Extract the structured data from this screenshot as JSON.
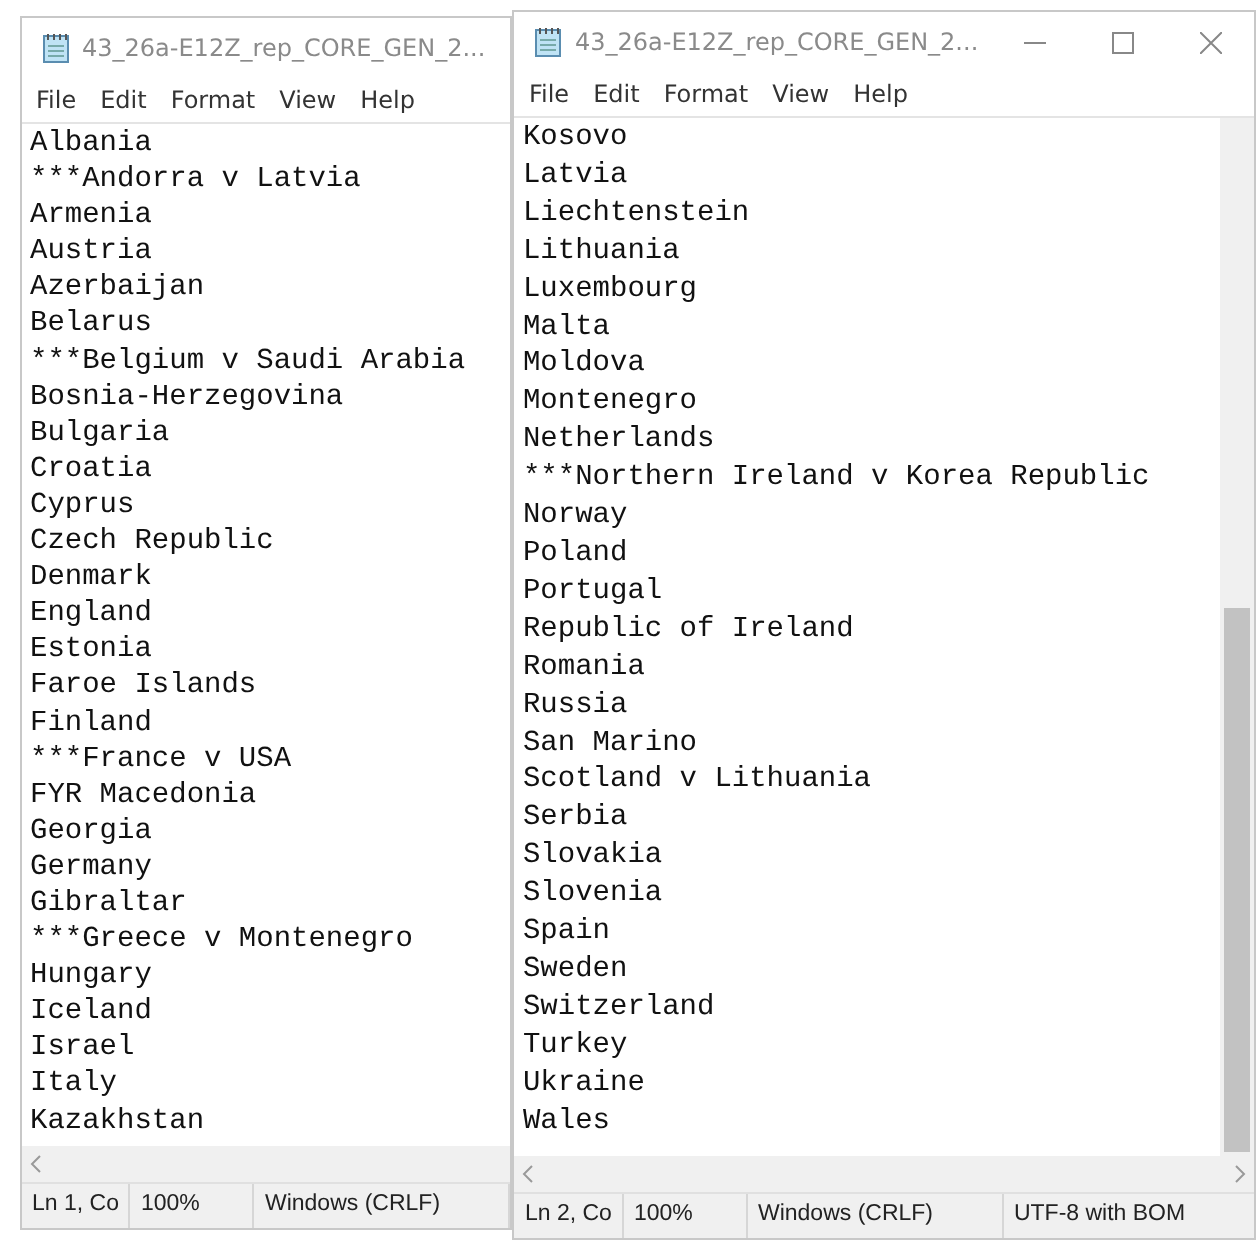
{
  "windows": [
    {
      "title": "43_26a-E12Z_rep_CORE_GEN_2...",
      "caption_buttons": false,
      "vertical_scrollbar": false,
      "menu": [
        "File",
        "Edit",
        "Format",
        "View",
        "Help"
      ],
      "lines": [
        "Albania",
        "***Andorra v Latvia",
        "Armenia",
        "Austria",
        "Azerbaijan",
        "Belarus",
        "***Belgium v Saudi Arabia",
        "Bosnia-Herzegovina",
        "Bulgaria",
        "Croatia",
        "Cyprus",
        "Czech Republic",
        "Denmark",
        "England",
        "Estonia",
        "Faroe Islands",
        "Finland",
        "***France v USA",
        "FYR Macedonia",
        "Georgia",
        "Germany",
        "Gibraltar",
        "***Greece v Montenegro",
        "Hungary",
        "Iceland",
        "Israel",
        "Italy",
        "Kazakhstan"
      ],
      "status": [
        "Ln 1, Co",
        "100%",
        "Windows (CRLF)"
      ]
    },
    {
      "title": "43_26a-E12Z_rep_CORE_GEN_2...",
      "caption_buttons": true,
      "vertical_scrollbar": true,
      "menu": [
        "File",
        "Edit",
        "Format",
        "View",
        "Help"
      ],
      "lines": [
        "Kosovo",
        "Latvia",
        "Liechtenstein",
        "Lithuania",
        "Luxembourg",
        "Malta",
        "Moldova",
        "Montenegro",
        "Netherlands",
        "***Northern Ireland v Korea Republic",
        "Norway",
        "Poland",
        "Portugal",
        "Republic of Ireland",
        "Romania",
        "Russia",
        "San Marino",
        "Scotland v Lithuania",
        "Serbia",
        "Slovakia",
        "Slovenia",
        "Spain",
        "Sweden",
        "Switzerland",
        "Turkey",
        "Ukraine",
        "Wales"
      ],
      "status": [
        "Ln 2, Co",
        "100%",
        "Windows (CRLF)",
        "UTF-8 with BOM"
      ]
    }
  ]
}
